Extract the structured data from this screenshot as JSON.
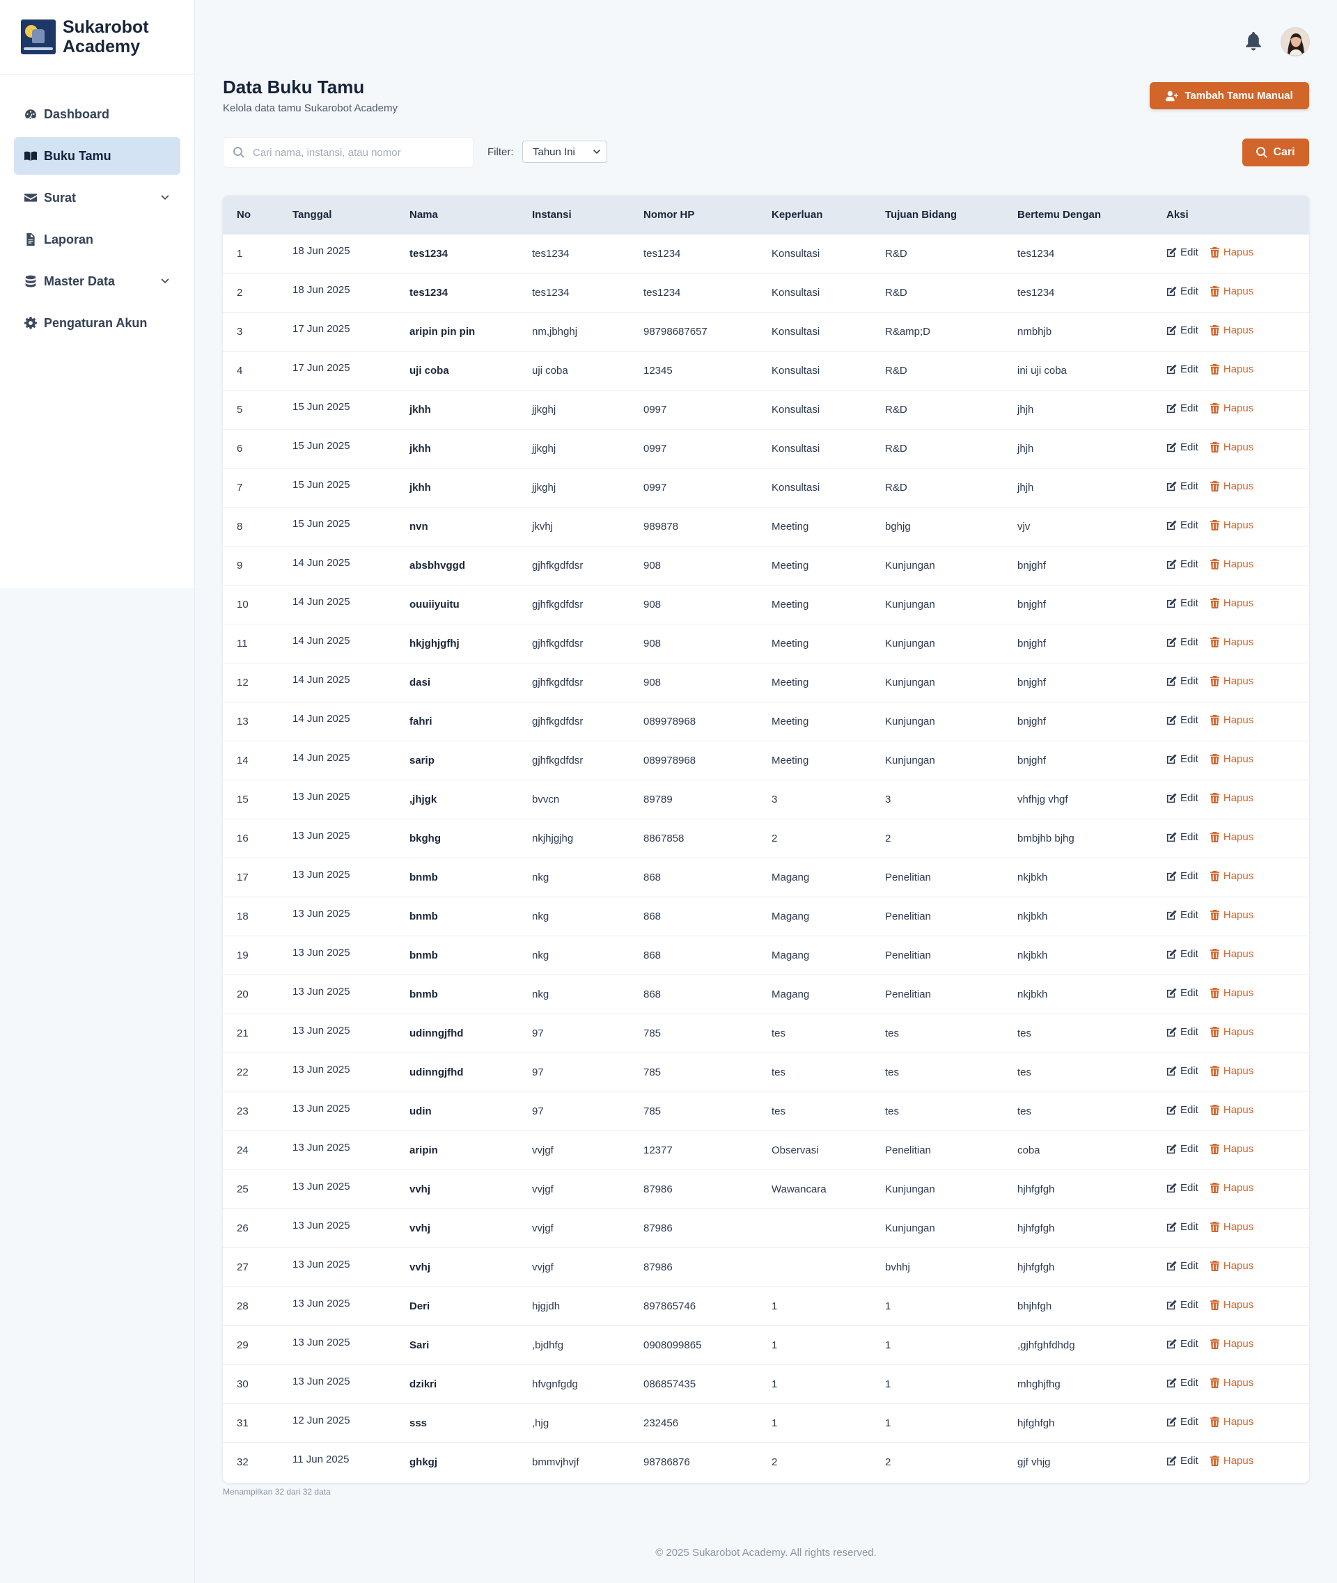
{
  "brand": {
    "name_line1": "Sukarobot",
    "name_line2": "Academy"
  },
  "sidebar": {
    "items": [
      {
        "label": "Dashboard",
        "icon": "gauge-icon",
        "active": false
      },
      {
        "label": "Buku Tamu",
        "icon": "book-icon",
        "active": true
      },
      {
        "label": "Surat",
        "icon": "envelope-icon",
        "active": false,
        "has_dropdown": true
      },
      {
        "label": "Laporan",
        "icon": "file-icon",
        "active": false
      },
      {
        "label": "Master Data",
        "icon": "database-icon",
        "active": false,
        "has_dropdown": true
      },
      {
        "label": "Pengaturan Akun",
        "icon": "gear-icon",
        "active": false
      }
    ]
  },
  "header": {
    "notification_icon": "bell-icon",
    "avatar": "user-avatar"
  },
  "page": {
    "title": "Data Buku Tamu",
    "subtitle": "Kelola data tamu Sukarobot Academy",
    "add_button": "Tambah Tamu Manual"
  },
  "search": {
    "placeholder": "Cari nama, instansi, atau nomor",
    "value": "",
    "filter_label": "Filter:",
    "filter_value": "Tahun Ini",
    "search_button": "Cari"
  },
  "table": {
    "headers": [
      "No",
      "Tanggal",
      "Nama",
      "Instansi",
      "Nomor HP",
      "Keperluan",
      "Tujuan Bidang",
      "Bertemu Dengan",
      "Aksi"
    ],
    "edit_label": "Edit",
    "delete_label": "Hapus",
    "rows": [
      [
        "1",
        "18 Jun 2025",
        "tes1234",
        "tes1234",
        "tes1234",
        "Konsultasi",
        "R&D",
        "tes1234"
      ],
      [
        "2",
        "18 Jun 2025",
        "tes1234",
        "tes1234",
        "tes1234",
        "Konsultasi",
        "R&D",
        "tes1234"
      ],
      [
        "3",
        "17 Jun 2025",
        "aripin pin pin",
        "nm,jbhghj",
        "98798687657",
        "Konsultasi",
        "R&amp;D",
        "nmbhjb"
      ],
      [
        "4",
        "17 Jun 2025",
        "uji coba",
        "uji coba",
        "12345",
        "Konsultasi",
        "R&D",
        "ini uji coba"
      ],
      [
        "5",
        "15 Jun 2025",
        "jkhh",
        "jjkghj",
        "0997",
        "Konsultasi",
        "R&D",
        "jhjh"
      ],
      [
        "6",
        "15 Jun 2025",
        "jkhh",
        "jjkghj",
        "0997",
        "Konsultasi",
        "R&D",
        "jhjh"
      ],
      [
        "7",
        "15 Jun 2025",
        "jkhh",
        "jjkghj",
        "0997",
        "Konsultasi",
        "R&D",
        "jhjh"
      ],
      [
        "8",
        "15 Jun 2025",
        "nvn",
        "jkvhj",
        "989878",
        "Meeting",
        "bghjg",
        "vjv"
      ],
      [
        "9",
        "14 Jun 2025",
        "absbhvggd",
        "gjhfkgdfdsr",
        "908",
        "Meeting",
        "Kunjungan",
        "bnjghf"
      ],
      [
        "10",
        "14 Jun 2025",
        "ouuiiyuitu",
        "gjhfkgdfdsr",
        "908",
        "Meeting",
        "Kunjungan",
        "bnjghf"
      ],
      [
        "11",
        "14 Jun 2025",
        "hkjghjgfhj",
        "gjhfkgdfdsr",
        "908",
        "Meeting",
        "Kunjungan",
        "bnjghf"
      ],
      [
        "12",
        "14 Jun 2025",
        "dasi",
        "gjhfkgdfdsr",
        "908",
        "Meeting",
        "Kunjungan",
        "bnjghf"
      ],
      [
        "13",
        "14 Jun 2025",
        "fahri",
        "gjhfkgdfdsr",
        "089978968",
        "Meeting",
        "Kunjungan",
        "bnjghf"
      ],
      [
        "14",
        "14 Jun 2025",
        "sarip",
        "gjhfkgdfdsr",
        "089978968",
        "Meeting",
        "Kunjungan",
        "bnjghf"
      ],
      [
        "15",
        "13 Jun 2025",
        ",jhjgk",
        "bvvcn",
        "89789",
        "3",
        "3",
        "vhfhjg vhgf"
      ],
      [
        "16",
        "13 Jun 2025",
        "bkghg",
        "nkjhjgjhg",
        "8867858",
        "2",
        "2",
        "bmbjhb bjhg"
      ],
      [
        "17",
        "13 Jun 2025",
        "bnmb",
        "nkg",
        "868",
        "Magang",
        "Penelitian",
        "nkjbkh"
      ],
      [
        "18",
        "13 Jun 2025",
        "bnmb",
        "nkg",
        "868",
        "Magang",
        "Penelitian",
        "nkjbkh"
      ],
      [
        "19",
        "13 Jun 2025",
        "bnmb",
        "nkg",
        "868",
        "Magang",
        "Penelitian",
        "nkjbkh"
      ],
      [
        "20",
        "13 Jun 2025",
        "bnmb",
        "nkg",
        "868",
        "Magang",
        "Penelitian",
        "nkjbkh"
      ],
      [
        "21",
        "13 Jun 2025",
        "udinngjfhd",
        "97",
        "785",
        "tes",
        "tes",
        "tes"
      ],
      [
        "22",
        "13 Jun 2025",
        "udinngjfhd",
        "97",
        "785",
        "tes",
        "tes",
        "tes"
      ],
      [
        "23",
        "13 Jun 2025",
        "udin",
        "97",
        "785",
        "tes",
        "tes",
        "tes"
      ],
      [
        "24",
        "13 Jun 2025",
        "aripin",
        "vvjgf",
        "12377",
        "Observasi",
        "Penelitian",
        "coba"
      ],
      [
        "25",
        "13 Jun 2025",
        "vvhj",
        "vvjgf",
        "87986",
        "Wawancara",
        "Kunjungan",
        "hjhfgfgh"
      ],
      [
        "26",
        "13 Jun 2025",
        "vvhj",
        "vvjgf",
        "87986",
        "",
        "Kunjungan",
        "hjhfgfgh"
      ],
      [
        "27",
        "13 Jun 2025",
        "vvhj",
        "vvjgf",
        "87986",
        "",
        "bvhhj",
        "hjhfgfgh"
      ],
      [
        "28",
        "13 Jun 2025",
        "Deri",
        "hjgjdh",
        "897865746",
        "1",
        "1",
        "bhjhfgh"
      ],
      [
        "29",
        "13 Jun 2025",
        "Sari",
        ",bjdhfg",
        "0908099865",
        "1",
        "1",
        ",gjhfghfdhdg"
      ],
      [
        "30",
        "13 Jun 2025",
        "dzikri",
        "hfvgnfgdg",
        "086857435",
        "1",
        "1",
        "mhghjfhg"
      ],
      [
        "31",
        "12 Jun 2025",
        "sss",
        ",hjg",
        "232456",
        "1",
        "1",
        "hjfghfgh"
      ],
      [
        "32",
        "11 Jun 2025",
        "ghkgj",
        "bmmvjhvjf",
        "98786876",
        "2",
        "2",
        "gjf vhjg"
      ]
    ],
    "summary": "Menampilkan 32 dari 32 data"
  },
  "footer": {
    "text": "© 2025 Sukarobot Academy. All rights reserved."
  },
  "colors": {
    "accent": "#d2652a",
    "active_nav": "#d3e3f4",
    "table_header": "#e3e9f1"
  }
}
